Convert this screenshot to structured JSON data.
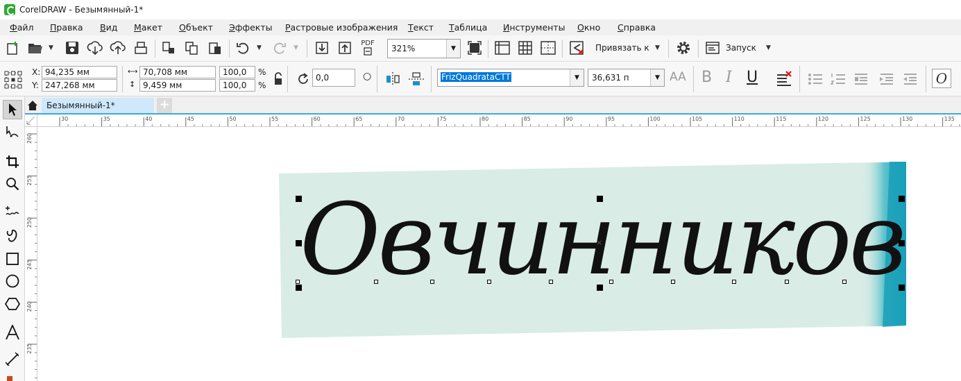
{
  "window": {
    "title": "CorelDRAW - Безымянный-1*"
  },
  "menu": [
    {
      "key": "Ф",
      "rest": "айл"
    },
    {
      "key": "П",
      "rest": "равка"
    },
    {
      "key": "В",
      "rest": "ид"
    },
    {
      "key": "М",
      "rest": "акет"
    },
    {
      "key": "О",
      "rest": "бъект"
    },
    {
      "key": "Э",
      "rest": "ффекты"
    },
    {
      "key": "Р",
      "rest": "астровые изображения"
    },
    {
      "key": "Т",
      "rest": "екст"
    },
    {
      "key": "Т",
      "rest": "аблица"
    },
    {
      "key": "И",
      "rest": "нструменты"
    },
    {
      "key": "О",
      "rest": "кно"
    },
    {
      "key": "С",
      "rest": "правка"
    }
  ],
  "toolbar": {
    "zoom": "321%",
    "snap_label": "Привязать к",
    "launch_label": "Запуск",
    "pdf_label": "PDF"
  },
  "properties": {
    "x_label": "X:",
    "y_label": "Y:",
    "x_value": "94,235 мм",
    "y_value": "247,268 мм",
    "width_value": "70,708 мм",
    "height_value": "9,459 мм",
    "scale_x": "100,0",
    "scale_y": "100,0",
    "percent": "%",
    "rotation": "0,0",
    "font_name": "FrizQuadrataCTT",
    "font_size": "36,631 п",
    "bold": "B",
    "italic": "I",
    "underline": "U",
    "aa": "AA"
  },
  "document_tab": {
    "name": "Безымянный-1*"
  },
  "ruler": {
    "h_labels": [
      "30",
      "35",
      "40",
      "45",
      "50",
      "55",
      "60",
      "65",
      "70",
      "75",
      "80",
      "85",
      "90",
      "95",
      "100",
      "105",
      "110",
      "115",
      "120",
      "125",
      "130",
      "135"
    ],
    "v_labels": [
      "260",
      "255",
      "250",
      "245",
      "240",
      "235"
    ]
  },
  "canvas": {
    "text": "Овчинников"
  },
  "colors": {
    "tab_accent": "#3aa9dd",
    "selected_font": "#0078d7",
    "photo_bg": "#d9ece6",
    "photo_teal": "#1aa0b8"
  }
}
